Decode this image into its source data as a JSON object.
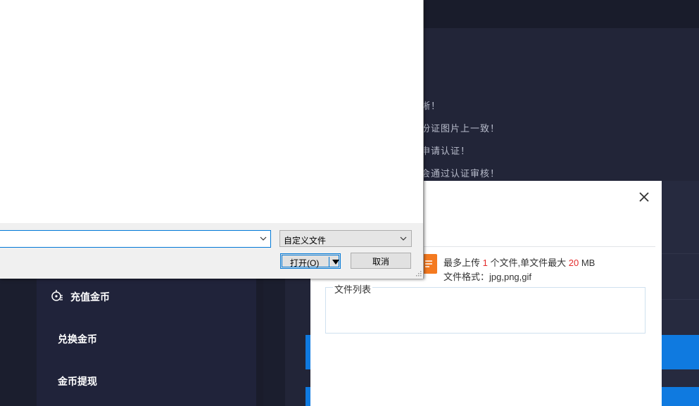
{
  "background_page": {
    "notes": [
      "晰！",
      "份证图片上一致！",
      "申请认证！",
      "会通过认证审核！"
    ],
    "sidebar": {
      "items": [
        {
          "label": "充值金币",
          "icon": "coin-icon"
        },
        {
          "label": "兑换金币"
        },
        {
          "label": "金币提现"
        }
      ]
    },
    "colors": {
      "background": "#1b1e2e",
      "accent_blue": "#0f7ae0"
    }
  },
  "upload_modal": {
    "limit_prefix": "最多上传",
    "max_files": "1",
    "limit_middle": "个文件,单文件最大",
    "max_size": "20",
    "size_unit": "MB",
    "formats_text": "文件格式：jpg,png,gif",
    "file_list_legend": "文件列表",
    "close_icon": "close-icon",
    "upload_icon": "upload-icon",
    "colors": {
      "highlight": "#e32b2b",
      "upload_icon": "#f47a20"
    }
  },
  "file_dialog": {
    "filename_value": "",
    "filetype_selected": "自定义文件",
    "open_label": "打开(O)",
    "cancel_label": "取消"
  }
}
